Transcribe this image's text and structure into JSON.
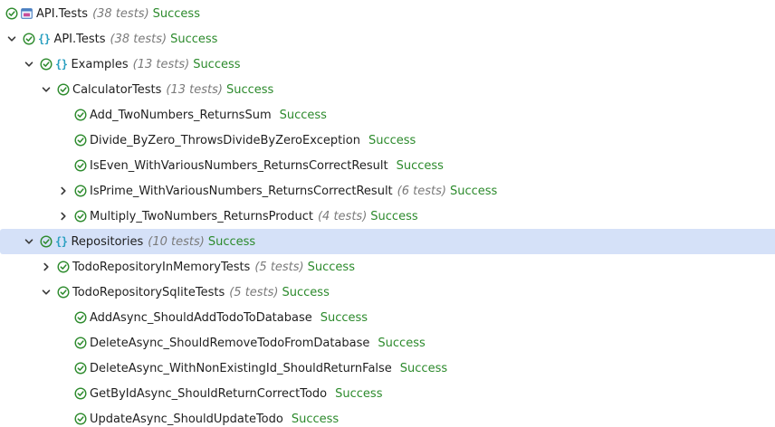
{
  "colors": {
    "success": "#2c8a2c",
    "namespace_icon": "#2a9fc0",
    "selection": "#d5e1f8",
    "count_text": "#7a7a7a"
  },
  "rows": [
    {
      "label": "API.Tests",
      "count": "(38 tests)",
      "result": "Success",
      "icon": "project-icon",
      "chevron": "none",
      "depth": 0
    },
    {
      "label": "API.Tests",
      "count": "(38 tests)",
      "result": "Success",
      "icon": "namespace-icon",
      "chevron": "expanded",
      "depth": 0
    },
    {
      "label": "Examples",
      "count": "(13 tests)",
      "result": "Success",
      "icon": "namespace-icon",
      "chevron": "expanded",
      "depth": 1
    },
    {
      "label": "CalculatorTests",
      "count": "(13 tests)",
      "result": "Success",
      "icon": "none",
      "chevron": "expanded",
      "depth": 2
    },
    {
      "label": "Add_TwoNumbers_ReturnsSum",
      "count": "",
      "result": "Success",
      "icon": "none",
      "chevron": "none",
      "depth": 3
    },
    {
      "label": "Divide_ByZero_ThrowsDivideByZeroException",
      "count": "",
      "result": "Success",
      "icon": "none",
      "chevron": "none",
      "depth": 3
    },
    {
      "label": "IsEven_WithVariousNumbers_ReturnsCorrectResult",
      "count": "",
      "result": "Success",
      "icon": "none",
      "chevron": "none",
      "depth": 3
    },
    {
      "label": "IsPrime_WithVariousNumbers_ReturnsCorrectResult",
      "count": "(6 tests)",
      "result": "Success",
      "icon": "none",
      "chevron": "collapsed",
      "depth": 3
    },
    {
      "label": "Multiply_TwoNumbers_ReturnsProduct",
      "count": "(4 tests)",
      "result": "Success",
      "icon": "none",
      "chevron": "collapsed",
      "depth": 3
    },
    {
      "label": "Repositories",
      "count": "(10 tests)",
      "result": "Success",
      "icon": "namespace-icon",
      "chevron": "expanded",
      "depth": 1,
      "selected": true
    },
    {
      "label": "TodoRepositoryInMemoryTests",
      "count": "(5 tests)",
      "result": "Success",
      "icon": "none",
      "chevron": "collapsed",
      "depth": 2
    },
    {
      "label": "TodoRepositorySqliteTests",
      "count": "(5 tests)",
      "result": "Success",
      "icon": "none",
      "chevron": "expanded",
      "depth": 2
    },
    {
      "label": "AddAsync_ShouldAddTodoToDatabase",
      "count": "",
      "result": "Success",
      "icon": "none",
      "chevron": "none",
      "depth": 3
    },
    {
      "label": "DeleteAsync_ShouldRemoveTodoFromDatabase",
      "count": "",
      "result": "Success",
      "icon": "none",
      "chevron": "none",
      "depth": 3
    },
    {
      "label": "DeleteAsync_WithNonExistingId_ShouldReturnFalse",
      "count": "",
      "result": "Success",
      "icon": "none",
      "chevron": "none",
      "depth": 3
    },
    {
      "label": "GetByIdAsync_ShouldReturnCorrectTodo",
      "count": "",
      "result": "Success",
      "icon": "none",
      "chevron": "none",
      "depth": 3
    },
    {
      "label": "UpdateAsync_ShouldUpdateTodo",
      "count": "",
      "result": "Success",
      "icon": "none",
      "chevron": "none",
      "depth": 3
    }
  ]
}
